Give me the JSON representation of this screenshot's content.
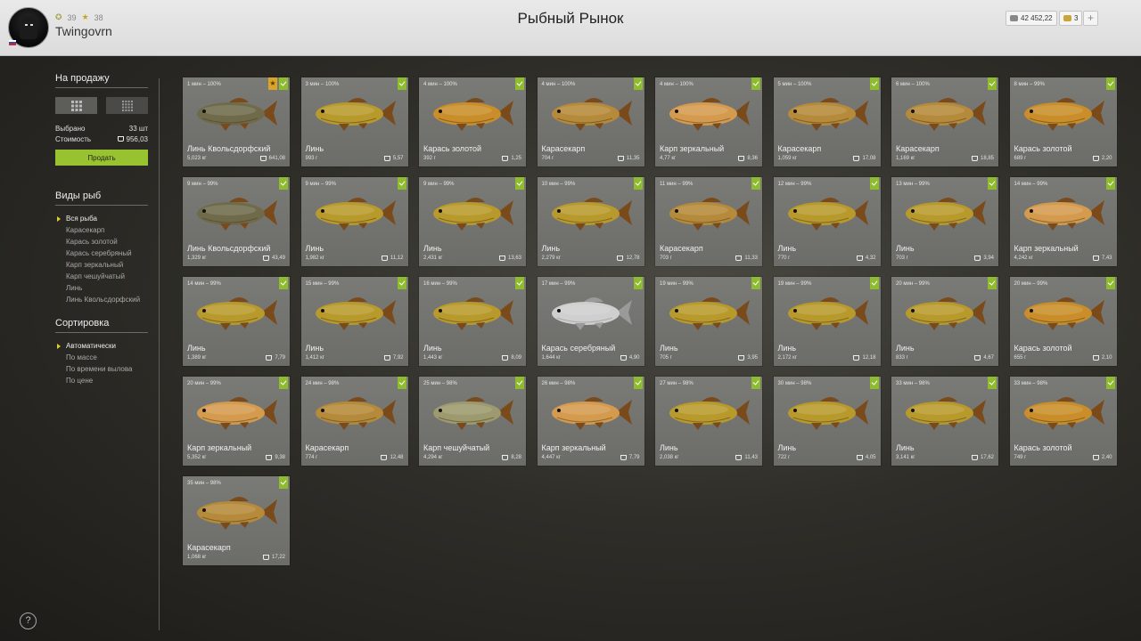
{
  "header": {
    "title": "Рыбный Рынок",
    "username": "Twingovrn",
    "level": "39",
    "stars": "38",
    "silver": "42 452,22",
    "gold": "3",
    "plus": "+"
  },
  "sidebar": {
    "for_sale_title": "На продажу",
    "selected_label": "Выбрано",
    "selected_value": "33 шт",
    "cost_label": "Стоимость",
    "cost_value": "956,03",
    "sell_button": "Продать",
    "fish_types_title": "Виды рыб",
    "fish_types": [
      {
        "label": "Вся рыба",
        "active": true
      },
      {
        "label": "Карасекарп",
        "active": false
      },
      {
        "label": "Карась золотой",
        "active": false
      },
      {
        "label": "Карась серебряный",
        "active": false
      },
      {
        "label": "Карп зеркальный",
        "active": false
      },
      {
        "label": "Карп чешуйчатый",
        "active": false
      },
      {
        "label": "Линь",
        "active": false
      },
      {
        "label": "Линь Квольсдорфский",
        "active": false
      }
    ],
    "sort_title": "Сортировка",
    "sort_options": [
      {
        "label": "Автоматически",
        "active": true
      },
      {
        "label": "По массе",
        "active": false
      },
      {
        "label": "По времени вылова",
        "active": false
      },
      {
        "label": "По цене",
        "active": false
      }
    ]
  },
  "help": "?",
  "fish_colors": {
    "Линь": "#b89a2c",
    "Линь Квольсдорфский": "#6f6a4a",
    "Карась золотой": "#c98e2a",
    "Карасекарп": "#b58a3a",
    "Карп зеркальный": "#d49a4e",
    "Карась серебряный": "#cfcfcf",
    "Карп чешуйчатый": "#9c9a6e"
  },
  "cards": [
    {
      "time": "1 мин – 100%",
      "name": "Линь Квольсдорфский",
      "weight": "5,023 кг",
      "price": "641,08",
      "star": true
    },
    {
      "time": "3 мин – 100%",
      "name": "Линь",
      "weight": "993 г",
      "price": "5,57"
    },
    {
      "time": "4 мин – 100%",
      "name": "Карась золотой",
      "weight": "392 г",
      "price": "1,25"
    },
    {
      "time": "4 мин – 100%",
      "name": "Карасекарп",
      "weight": "704 г",
      "price": "11,35"
    },
    {
      "time": "4 мин – 100%",
      "name": "Карп зеркальный",
      "weight": "4,77 кг",
      "price": "8,36"
    },
    {
      "time": "5 мин – 100%",
      "name": "Карасекарп",
      "weight": "1,059 кг",
      "price": "17,08"
    },
    {
      "time": "6 мин – 100%",
      "name": "Карасекарп",
      "weight": "1,169 кг",
      "price": "18,85"
    },
    {
      "time": "8 мин – 99%",
      "name": "Карась золотой",
      "weight": "689 г",
      "price": "2,20"
    },
    {
      "time": "9 мин – 99%",
      "name": "Линь Квольсдорфский",
      "weight": "1,329 кг",
      "price": "43,49"
    },
    {
      "time": "9 мин – 99%",
      "name": "Линь",
      "weight": "1,982 кг",
      "price": "11,12"
    },
    {
      "time": "9 мин – 99%",
      "name": "Линь",
      "weight": "2,431 кг",
      "price": "13,63"
    },
    {
      "time": "10 мин – 99%",
      "name": "Линь",
      "weight": "2,279 кг",
      "price": "12,78"
    },
    {
      "time": "11 мин – 99%",
      "name": "Карасекарп",
      "weight": "703 г",
      "price": "11,33"
    },
    {
      "time": "12 мин – 99%",
      "name": "Линь",
      "weight": "770 г",
      "price": "4,32"
    },
    {
      "time": "13 мин – 99%",
      "name": "Линь",
      "weight": "703 г",
      "price": "3,94"
    },
    {
      "time": "14 мин – 99%",
      "name": "Карп зеркальный",
      "weight": "4,242 кг",
      "price": "7,43"
    },
    {
      "time": "14 мин – 99%",
      "name": "Линь",
      "weight": "1,389 кг",
      "price": "7,79"
    },
    {
      "time": "15 мин – 99%",
      "name": "Линь",
      "weight": "1,412 кг",
      "price": "7,92"
    },
    {
      "time": "16 мин – 99%",
      "name": "Линь",
      "weight": "1,443 кг",
      "price": "8,09"
    },
    {
      "time": "17 мин – 99%",
      "name": "Карась серебряный",
      "weight": "1,644 кг",
      "price": "4,90"
    },
    {
      "time": "19 мин – 99%",
      "name": "Линь",
      "weight": "705 г",
      "price": "3,95"
    },
    {
      "time": "19 мин – 99%",
      "name": "Линь",
      "weight": "2,172 кг",
      "price": "12,18"
    },
    {
      "time": "20 мин – 99%",
      "name": "Линь",
      "weight": "833 г",
      "price": "4,67"
    },
    {
      "time": "20 мин – 99%",
      "name": "Карась золотой",
      "weight": "655 г",
      "price": "2,10"
    },
    {
      "time": "20 мин – 99%",
      "name": "Карп зеркальный",
      "weight": "5,352 кг",
      "price": "9,38"
    },
    {
      "time": "24 мин – 98%",
      "name": "Карасекарп",
      "weight": "774 г",
      "price": "12,48"
    },
    {
      "time": "25 мин – 98%",
      "name": "Карп чешуйчатый",
      "weight": "4,294 кг",
      "price": "8,28"
    },
    {
      "time": "26 мин – 98%",
      "name": "Карп зеркальный",
      "weight": "4,447 кг",
      "price": "7,79"
    },
    {
      "time": "27 мин – 98%",
      "name": "Линь",
      "weight": "2,038 кг",
      "price": "11,43"
    },
    {
      "time": "30 мин – 98%",
      "name": "Линь",
      "weight": "722 г",
      "price": "4,05"
    },
    {
      "time": "33 мин – 98%",
      "name": "Линь",
      "weight": "3,141 кг",
      "price": "17,62"
    },
    {
      "time": "33 мин – 98%",
      "name": "Карась золотой",
      "weight": "749 г",
      "price": "2,40"
    },
    {
      "time": "35 мин – 98%",
      "name": "Карасекарп",
      "weight": "1,068 кг",
      "price": "17,22"
    }
  ]
}
